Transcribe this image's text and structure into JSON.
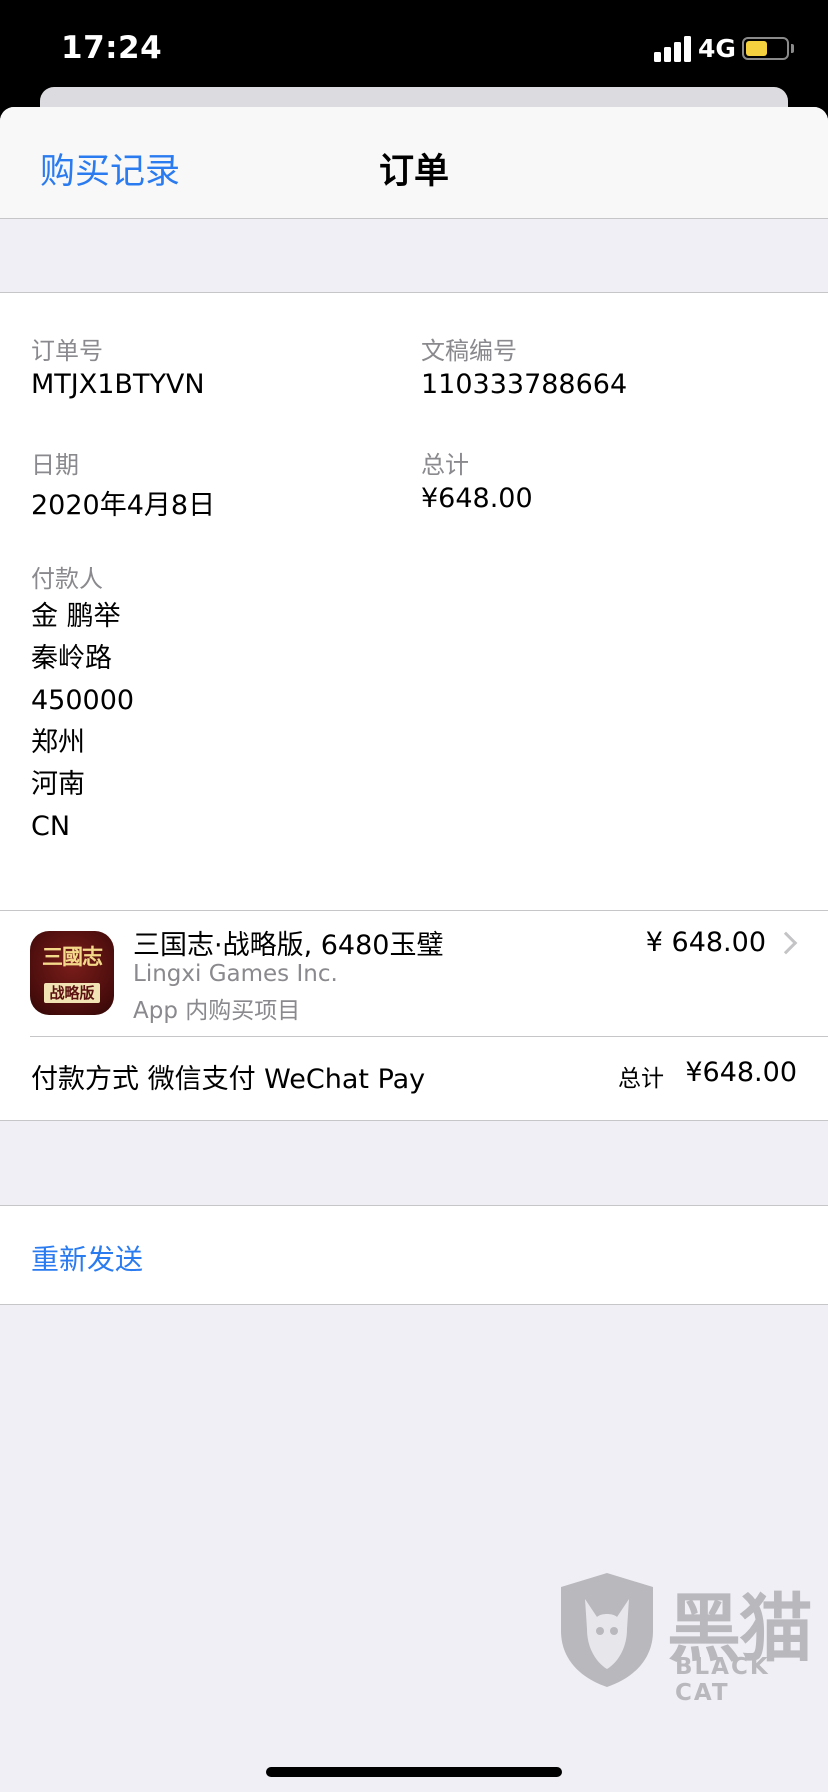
{
  "status_bar": {
    "time": "17:24",
    "network": "4G",
    "battery_level": 0.55,
    "signal_bars": 4
  },
  "nav": {
    "back_label": "购买记录",
    "title": "订单"
  },
  "order": {
    "order_no_label": "订单号",
    "order_no": "MTJX1BTYVN",
    "doc_no_label": "文稿编号",
    "doc_no": "110333788664",
    "date_label": "日期",
    "date": "2020年4月8日",
    "total_label": "总计",
    "total": "¥648.00"
  },
  "payer": {
    "label": "付款人",
    "lines": [
      "金 鹏举",
      "秦岭路",
      "450000",
      "郑州",
      "河南",
      "CN"
    ]
  },
  "item": {
    "icon_title": "三國志",
    "icon_subtitle": "战略版",
    "name": "三国志·战略版, 6480玉璧",
    "developer": "Lingxi Games Inc.",
    "type": "App 内购买项目",
    "price": "¥ 648.00"
  },
  "payment": {
    "method": "付款方式 微信支付 WeChat Pay",
    "total_label": "总计",
    "total": "¥648.00"
  },
  "actions": {
    "resend": "重新发送"
  },
  "watermark": {
    "logo_text": "黑猫",
    "logo_sub": "BLACK CAT"
  },
  "colors": {
    "accent": "#2a7bf0",
    "background": "#f0eff5",
    "battery": "#f5d13f"
  },
  "icons": [
    "signal-icon",
    "battery-icon",
    "chevron-right-icon",
    "app-icon",
    "black-cat-logo-icon"
  ]
}
